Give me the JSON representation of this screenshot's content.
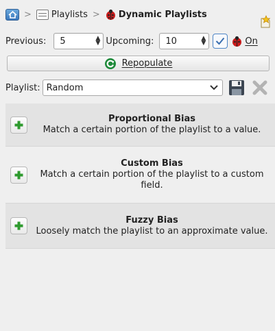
{
  "breadcrumb": {
    "items": [
      "Playlists",
      "Dynamic Playlists"
    ]
  },
  "counts": {
    "previous_label": "Previous:",
    "previous_value": "5",
    "upcoming_label": "Upcoming:",
    "upcoming_value": "10",
    "on_label": "On",
    "checked": true
  },
  "repopulate": {
    "label": "Repopulate"
  },
  "playlist": {
    "label": "Playlist:",
    "selected": "Random"
  },
  "biases": [
    {
      "title": "Proportional Bias",
      "description": "Match a certain portion of the playlist to a value."
    },
    {
      "title": "Custom Bias",
      "description": "Match a certain portion of the playlist to a custom field."
    },
    {
      "title": "Fuzzy Bias",
      "description": "Loosely match the playlist to an approximate value."
    }
  ],
  "icons": {
    "home": "home-icon",
    "playlist": "playlist-icon",
    "dynamic": "ladybug-icon",
    "bookmark": "bookmark-star-icon",
    "repopulate": "refresh-icon",
    "save": "floppy-disk-icon",
    "delete": "delete-x-icon",
    "add": "green-plus-icon"
  },
  "colors": {
    "accent_blue": "#4f86c6",
    "plus_green": "#2e9a2e",
    "refresh_green": "#1e8a3a",
    "ladybug_red": "#c81c1c"
  }
}
